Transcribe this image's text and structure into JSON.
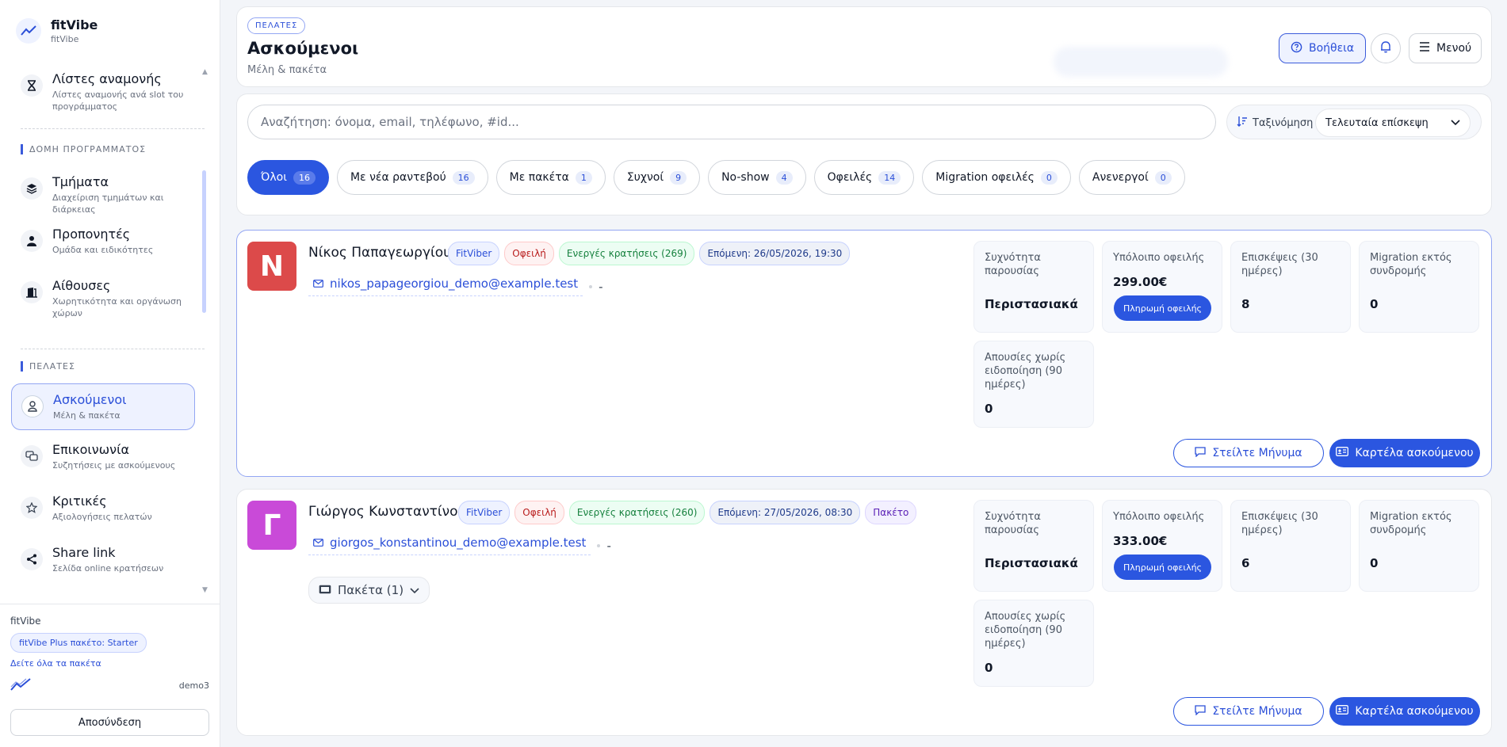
{
  "brand": {
    "name": "fitVibe",
    "sub": "fitVibe"
  },
  "sidebar": {
    "top_item": {
      "title": "Λίστες αναμονής",
      "desc": "Λίστες αναμονής ανά slot του προγράμματος"
    },
    "section_structure": "ΔΟΜΗ ΠΡΟΓΡΑΜΜΑΤΟΣ",
    "structure_items": [
      {
        "title": "Τμήματα",
        "desc": "Διαχείριση τμημάτων και διάρκειας"
      },
      {
        "title": "Προπονητές",
        "desc": "Ομάδα και ειδικότητες"
      },
      {
        "title": "Αίθουσες",
        "desc": "Χωρητικότητα και οργάνωση χώρων"
      }
    ],
    "section_clients": "ΠΕΛΑΤΕΣ",
    "client_items": [
      {
        "title": "Ασκούμενοι",
        "desc": "Μέλη & πακέτα"
      },
      {
        "title": "Επικοινωνία",
        "desc": "Συζητήσεις με ασκούμενους"
      },
      {
        "title": "Κριτικές",
        "desc": "Αξιολογήσεις πελατών"
      },
      {
        "title": "Share link",
        "desc": "Σελίδα online κρατήσεων"
      }
    ],
    "footer": {
      "brand": "fitVibe",
      "plan": "fitVibe Plus πακέτο: Starter",
      "plans_link": "Δείτε όλα τα πακέτα",
      "user": "demo3",
      "logout": "Αποσύνδεση"
    }
  },
  "header": {
    "badge": "ΠΕΛΑΤΕΣ",
    "title": "Ασκούμενοι",
    "subtitle": "Μέλη & πακέτα",
    "help": "Βοήθεια",
    "menu": "Μενού"
  },
  "search": {
    "placeholder": "Αναζήτηση: όνομα, email, τηλέφωνο, #id...",
    "sort_label": "Ταξινόμηση",
    "sort_value": "Τελευταία επίσκεψη"
  },
  "filters": [
    {
      "label": "Όλοι",
      "count": "16"
    },
    {
      "label": "Με νέα ραντεβού",
      "count": "16"
    },
    {
      "label": "Με πακέτα",
      "count": "1"
    },
    {
      "label": "Συχνοί",
      "count": "9"
    },
    {
      "label": "No-show",
      "count": "4"
    },
    {
      "label": "Οφειλές",
      "count": "14"
    },
    {
      "label": "Migration οφειλές",
      "count": "0"
    },
    {
      "label": "Ανενεργοί",
      "count": "0"
    }
  ],
  "clients": [
    {
      "initial": "N",
      "name": "Νίκος Παπαγεωργίου",
      "tags": [
        "FitViber",
        "Οφειλή",
        "Ενεργές κρατήσεις (269)",
        "Επόμενη:  26/05/2026, 19:30"
      ],
      "email": "nikos_papageorgiou_demo@example.test",
      "phone": "-",
      "stats": {
        "frequency_label": "Συχνότητα παρουσίας",
        "frequency_value": "Περιστασιακά",
        "balance_label": "Υπόλοιπο οφειλής",
        "balance_value": "299.00€",
        "pay_label": "Πληρωμή οφειλής",
        "visits_label": "Επισκέψεις (30 ημέρες)",
        "visits_value": "8",
        "migration_label": "Migration εκτός συνδρομής",
        "migration_value": "0",
        "absences_label": "Απουσίες χωρίς ειδοποίηση (90 ημέρες)",
        "absences_value": "0"
      },
      "message_btn": "Στείλτε Μήνυμα",
      "card_btn": "Καρτέλα ασκούμενου"
    },
    {
      "initial": "Γ",
      "name": "Γιώργος Κωνσταντίνου",
      "tags": [
        "FitViber",
        "Οφειλή",
        "Ενεργές κρατήσεις (260)",
        "Επόμενη:  27/05/2026, 08:30",
        "Πακέτο"
      ],
      "email": "giorgos_konstantinou_demo@example.test",
      "phone": "-",
      "packages": "Πακέτα (1)",
      "stats": {
        "frequency_label": "Συχνότητα παρουσίας",
        "frequency_value": "Περιστασιακά",
        "balance_label": "Υπόλοιπο οφειλής",
        "balance_value": "333.00€",
        "pay_label": "Πληρωμή οφειλής",
        "visits_label": "Επισκέψεις (30 ημέρες)",
        "visits_value": "6",
        "migration_label": "Migration εκτός συνδρομής",
        "migration_value": "0",
        "absences_label": "Απουσίες χωρίς ειδοποίηση (90 ημέρες)",
        "absences_value": "0"
      },
      "message_btn": "Στείλτε Μήνυμα",
      "card_btn": "Καρτέλα ασκούμενου"
    }
  ],
  "colors": {
    "accent": "#2b56e0",
    "avatar_1": "#dc4a4a",
    "avatar_2": "#c94ad8"
  }
}
